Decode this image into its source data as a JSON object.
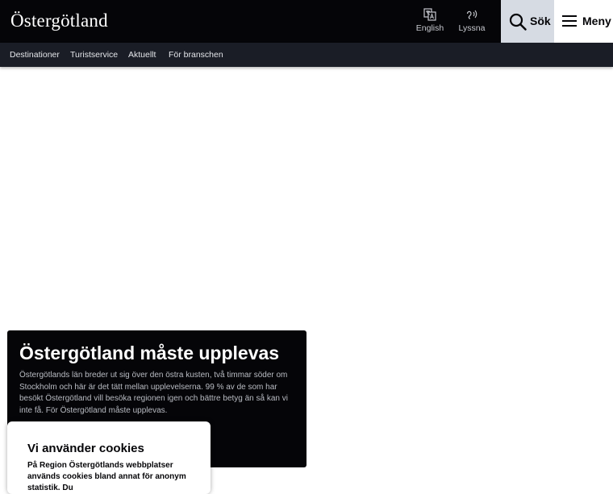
{
  "header": {
    "logo": "Östergötland",
    "english_label": "English",
    "listen_label": "Lyssna",
    "search_label": "Sök",
    "menu_label": "Meny"
  },
  "subnav": {
    "items": [
      {
        "label": "Destinationer"
      },
      {
        "label": "Turistservice"
      },
      {
        "label": "Aktuellt"
      },
      {
        "label": "För branschen"
      }
    ]
  },
  "hero": {
    "title": "Östergötland måste upplevas",
    "text": "Östergötlands län breder ut sig över den östra kusten, två timmar söder om Stockholm och här är det tätt mellan upplevelserna. 99 % av de som har besökt Östergötland vill besöka regionen igen och bättre betyg än så kan vi inte få. För Östergötland måste upplevas."
  },
  "cookie": {
    "title": "Vi använder cookies",
    "text": "På Region Östergötlands webbplatser används cookies bland annat för anonym statistik. Du"
  },
  "colors": {
    "header_bg": "#050508",
    "subnav_bg": "#1a1d26",
    "search_bg": "#d6dbe3",
    "hero_bg": "#050508"
  },
  "icons": {
    "english": "translate-icon",
    "listen": "ear-icon",
    "search": "search-icon",
    "menu": "hamburger-icon"
  }
}
